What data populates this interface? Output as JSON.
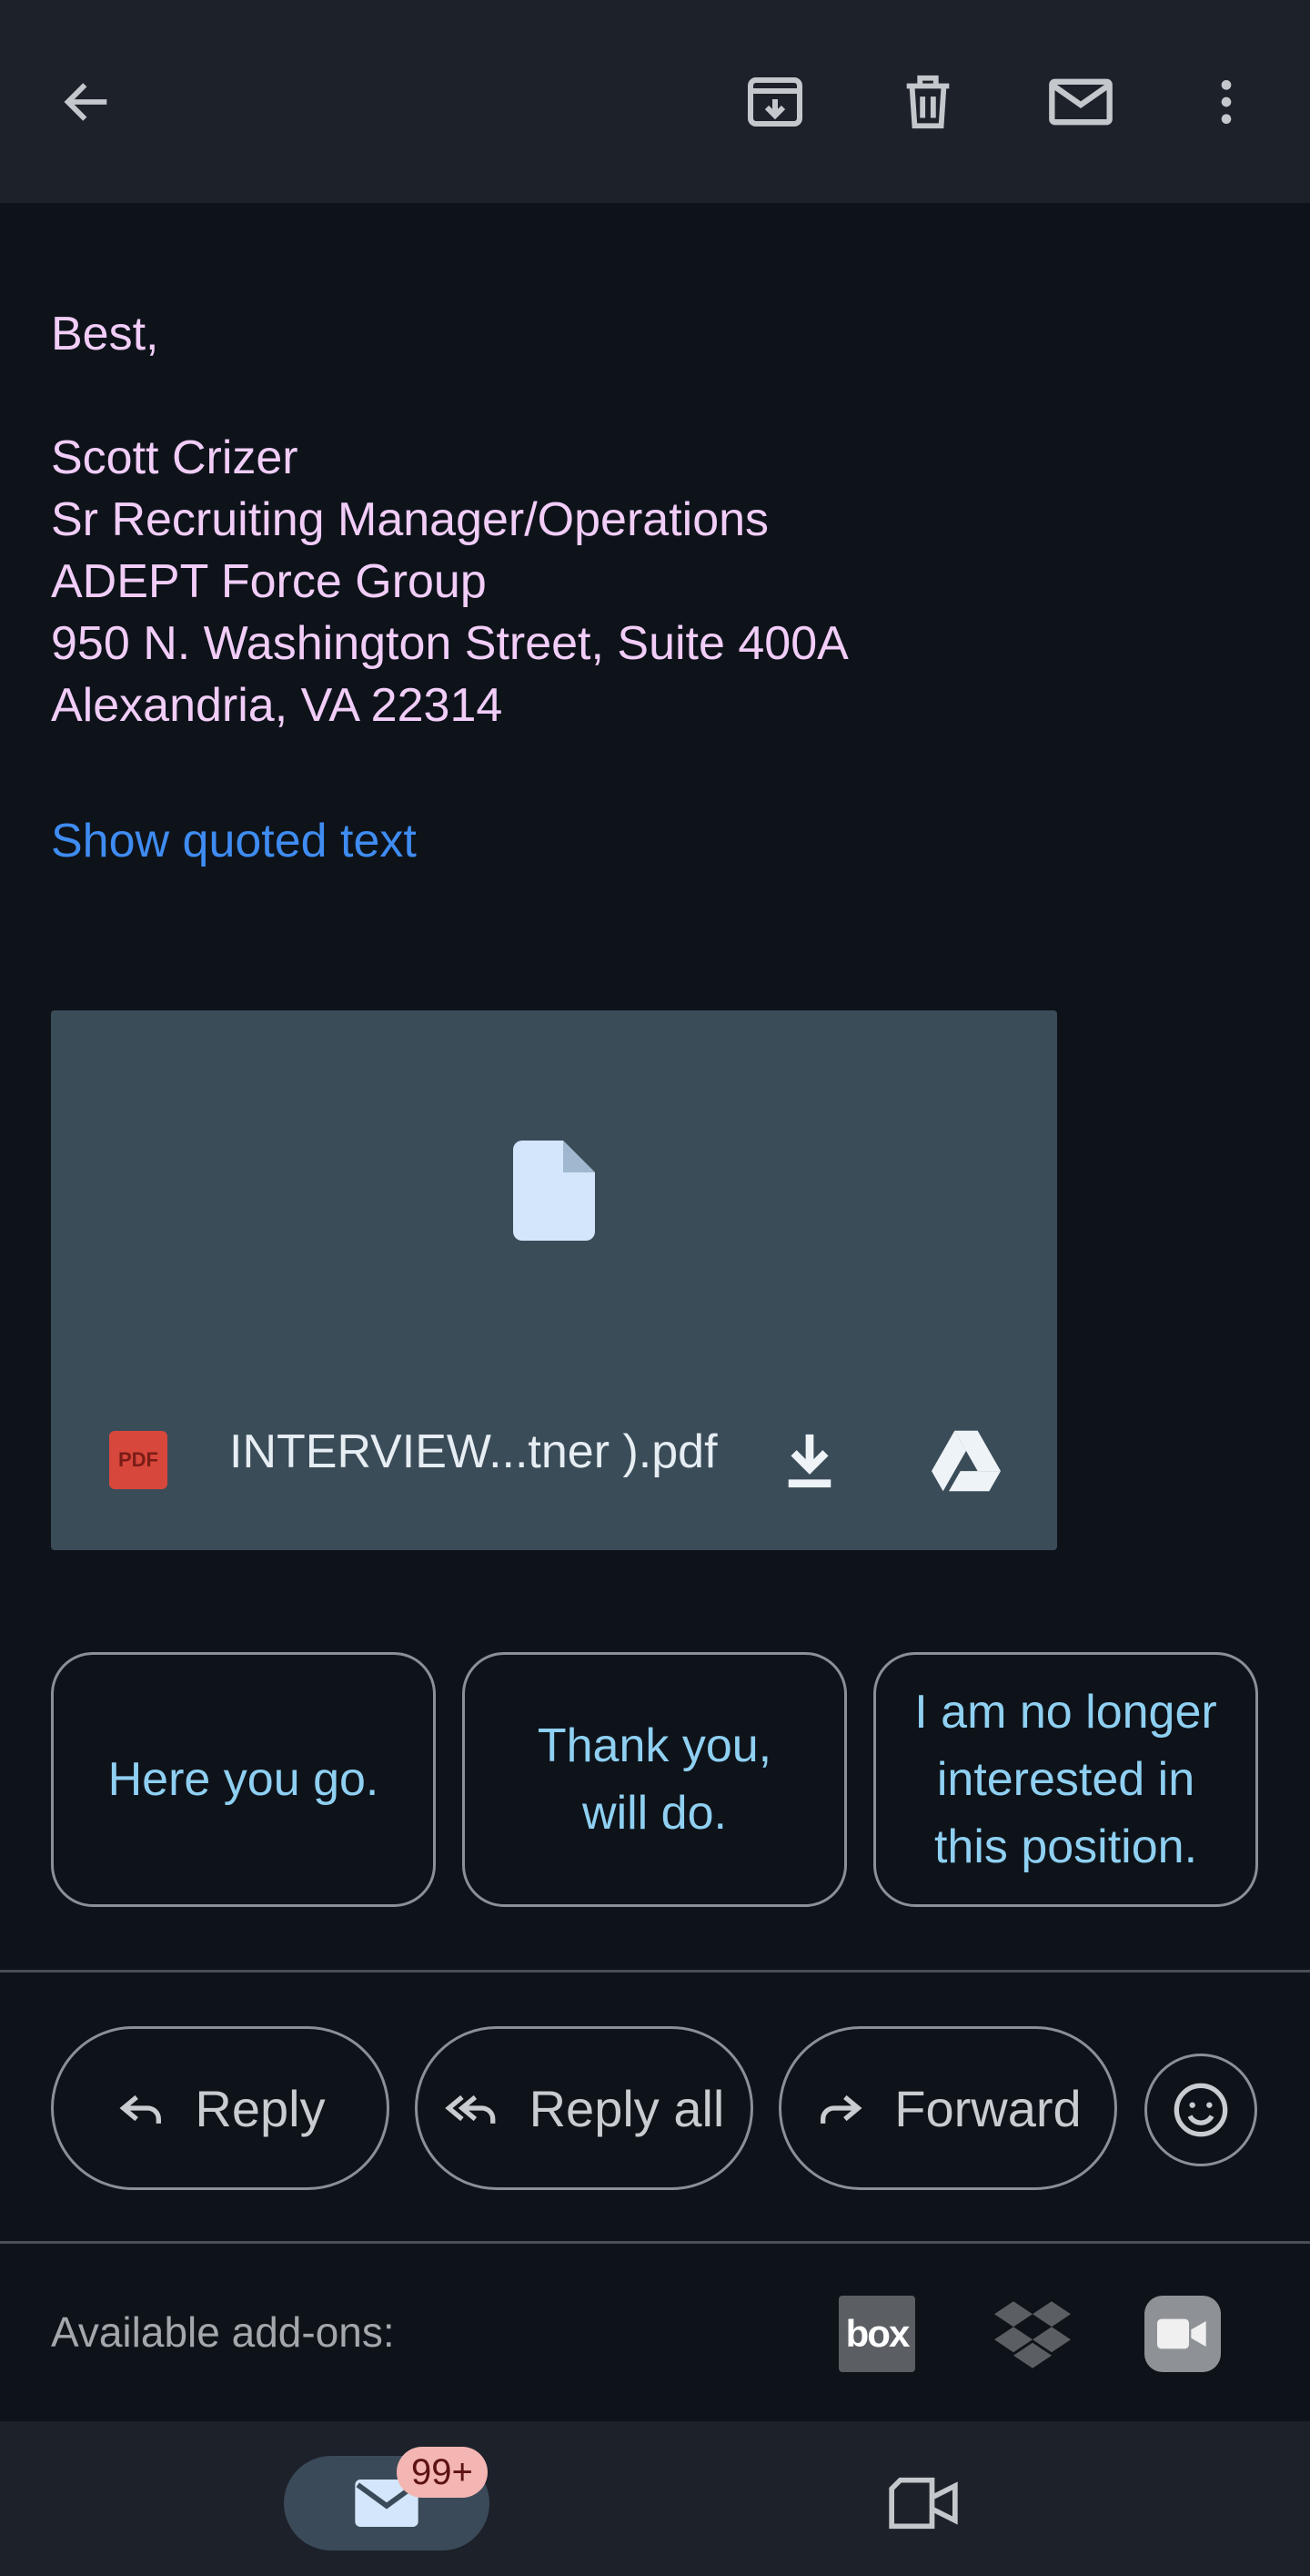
{
  "toolbar": {
    "back_icon": "arrow-back-icon",
    "archive_icon": "archive-icon",
    "delete_icon": "trash-icon",
    "mark_unread_icon": "mail-icon",
    "more_icon": "more-vert-icon"
  },
  "message": {
    "closing": "Best,",
    "signature": [
      "Scott Crizer",
      "Sr Recruiting Manager/Operations",
      "ADEPT Force Group",
      "950 N. Washington Street, Suite 400A",
      "Alexandria, VA 22314"
    ],
    "show_quoted": "Show quoted text"
  },
  "attachment": {
    "type_label": "PDF",
    "file_name": "INTERVIEW...tner ).pdf",
    "download_icon": "download-icon",
    "drive_icon": "google-drive-icon"
  },
  "smart_replies": [
    "Here you go.",
    "Thank you,\nwill do.",
    "I am no longer\ninterested in\nthis position."
  ],
  "actions": {
    "reply": "Reply",
    "reply_all": "Reply all",
    "forward": "Forward",
    "emoji_icon": "emoji-icon"
  },
  "addons": {
    "label": "Available add-ons:",
    "items": [
      "box",
      "dropbox-icon",
      "video-camera-icon"
    ]
  },
  "bottom_nav": {
    "mail_badge": "99+",
    "mail_icon": "mail-icon",
    "meet_icon": "video-icon"
  },
  "colors": {
    "background": "#0e131a",
    "toolbar": "#1c212a",
    "signature_text": "#f1cdf8",
    "link": "#3f8cf2",
    "chip_text": "#8fd0f2",
    "attachment_bg": "#3b4c59",
    "badge_bg": "#f4b6b3"
  }
}
